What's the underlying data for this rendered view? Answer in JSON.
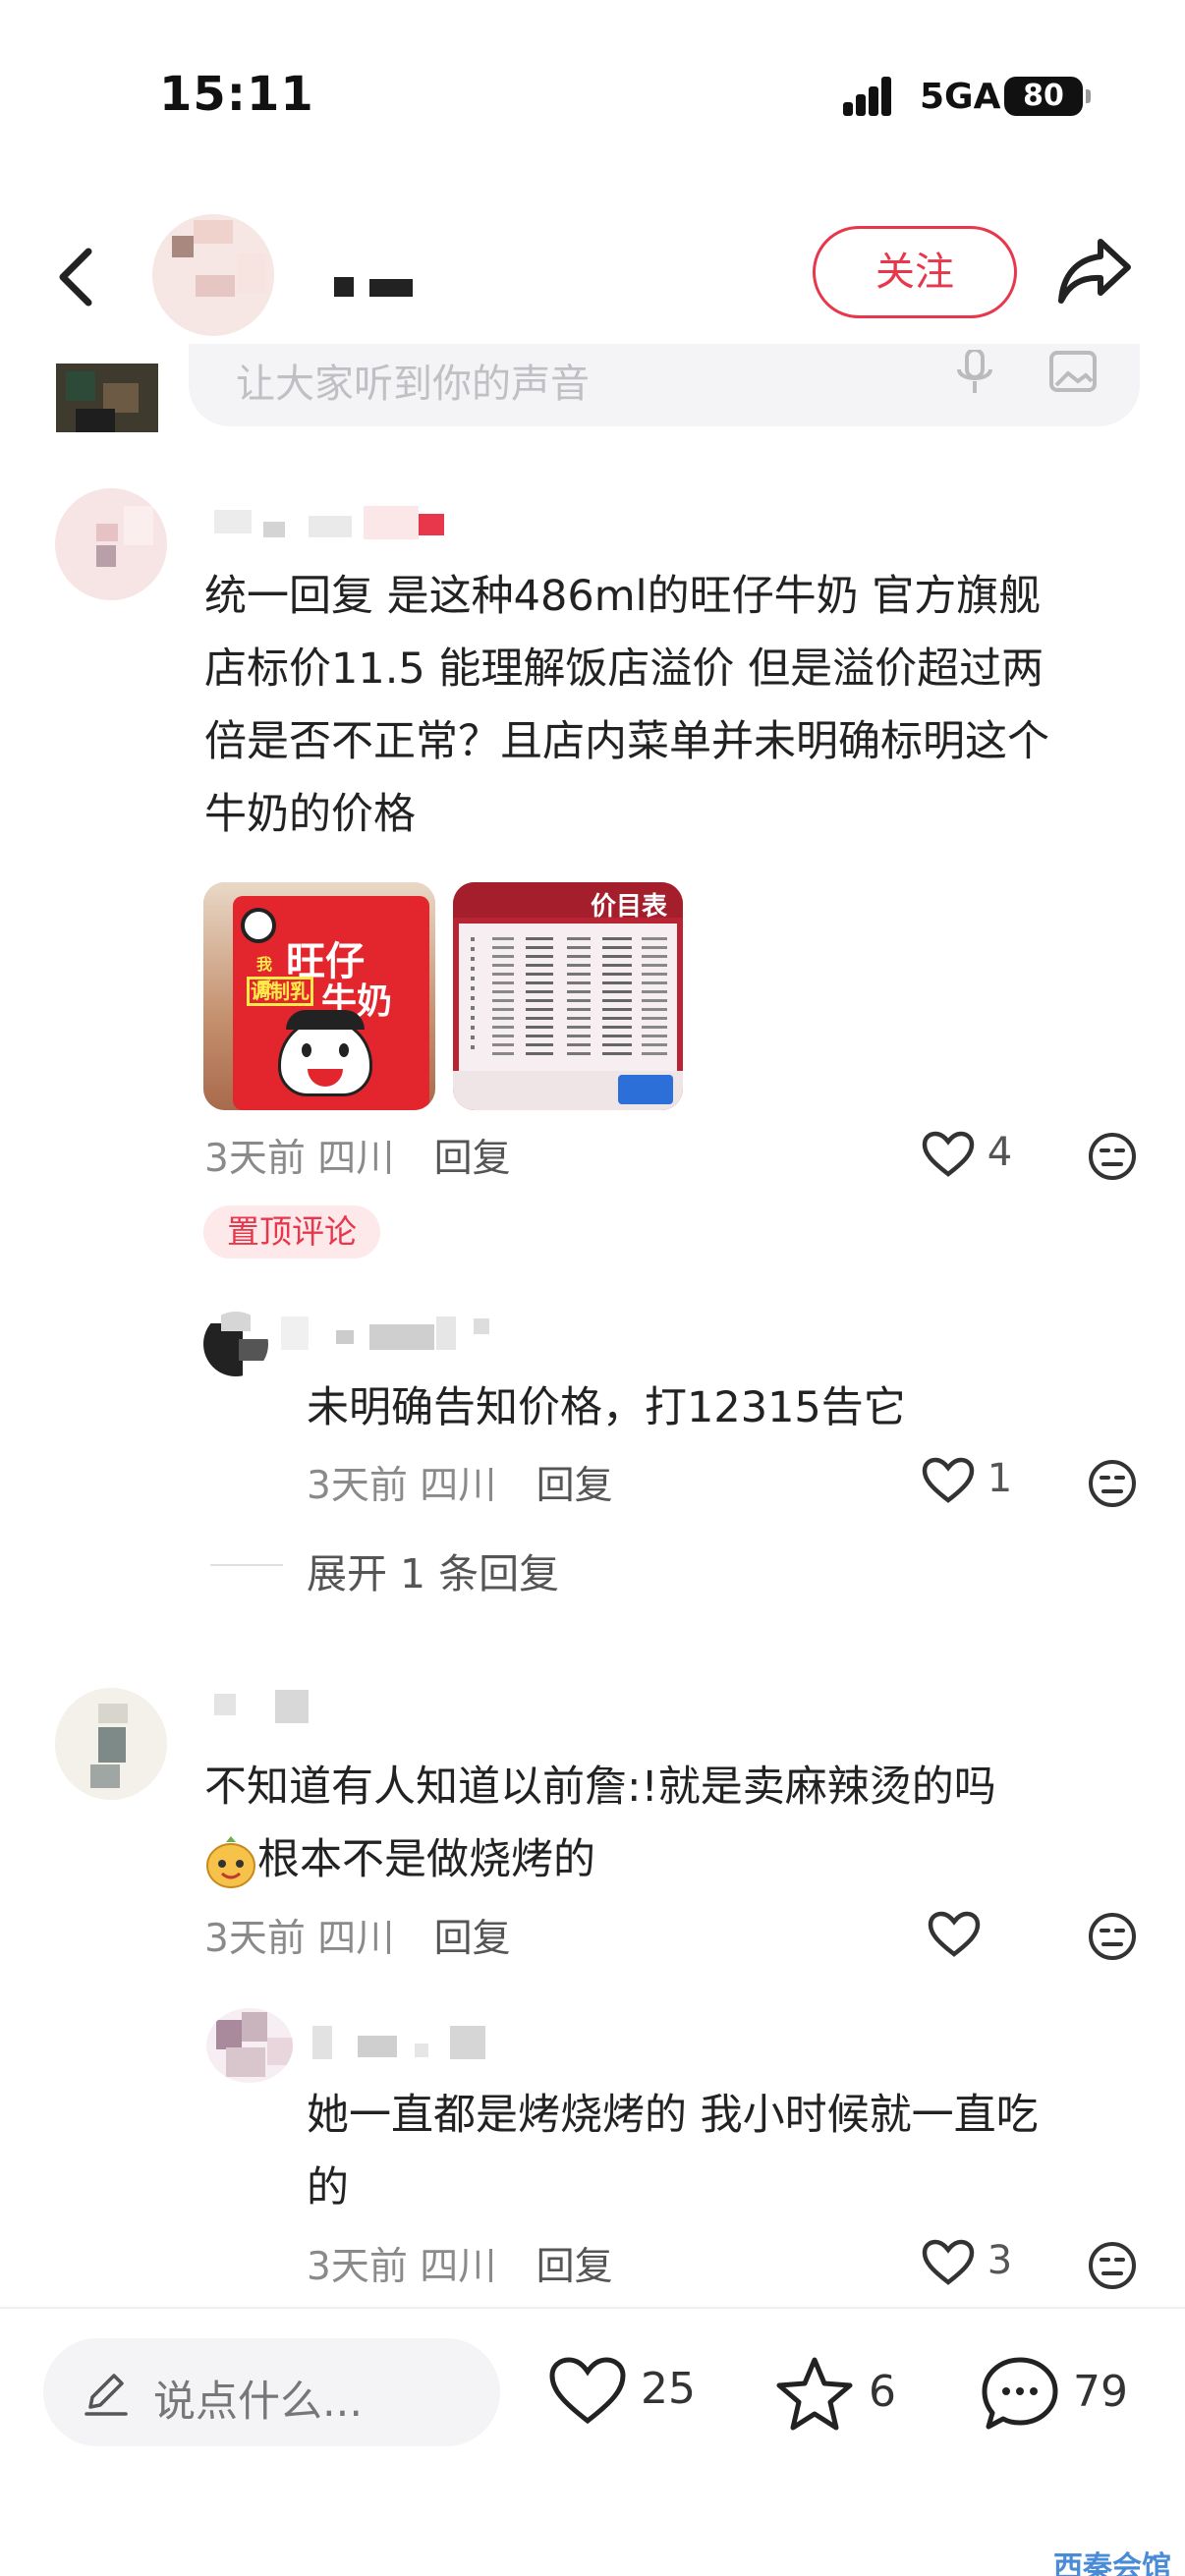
{
  "status_bar": {
    "time": "15:11",
    "network": "5GA",
    "battery": "80"
  },
  "header": {
    "follow_label": "关注"
  },
  "comment_input": {
    "placeholder": "让大家听到你的声音"
  },
  "comments": [
    {
      "text_lines": [
        "统一回复 是这种486ml的旺仔牛奶 官方旗舰",
        "店标价11.5 能理解饭店溢价 但是溢价超过两",
        "倍是否不正常？且店内菜单并未明确标明这个",
        "牛奶的价格"
      ],
      "images": [
        {
          "type": "product-photo",
          "brand": "旺仔",
          "label": "牛奶",
          "sublabel": "我爱",
          "tag": "调制乳"
        },
        {
          "type": "menu-photo",
          "title": "价目表"
        }
      ],
      "time": "3天前",
      "location": "四川",
      "reply_label": "回复",
      "likes": "4",
      "badge": "置顶评论",
      "replies": [
        {
          "text": "未明确告知价格，打12315告它",
          "time": "3天前",
          "location": "四川",
          "reply_label": "回复",
          "likes": "1"
        }
      ],
      "expand_label": "展开 1 条回复"
    },
    {
      "text_line1": "不知道有人知道以前詹:!就是卖麻辣烫的吗",
      "text_line2": "根本不是做烧烤的",
      "time": "3天前",
      "location": "四川",
      "reply_label": "回复",
      "likes": "",
      "replies": [
        {
          "text_lines": [
            "她一直都是烤烧烤的 我小时候就一直吃",
            "的"
          ],
          "time": "3天前",
          "location": "四川",
          "reply_label": "回复",
          "likes": "3"
        }
      ]
    }
  ],
  "bottom_bar": {
    "say_placeholder": "说点什么...",
    "likes": "25",
    "favorites": "6",
    "comments": "79"
  },
  "watermark": "西秦会馆",
  "colors": {
    "accent": "#e8364b",
    "pinned_bg": "#fde8ea",
    "input_bg": "#f4f4f6"
  }
}
